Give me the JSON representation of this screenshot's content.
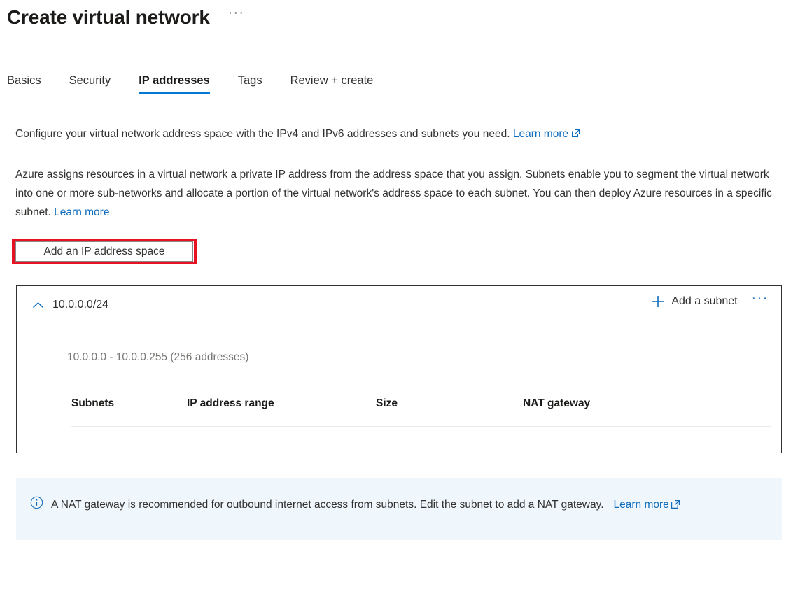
{
  "header": {
    "title": "Create virtual network",
    "ellipsis": "···"
  },
  "tabs": [
    {
      "label": "Basics",
      "active": false
    },
    {
      "label": "Security",
      "active": false
    },
    {
      "label": "IP addresses",
      "active": true
    },
    {
      "label": "Tags",
      "active": false
    },
    {
      "label": "Review + create",
      "active": false
    }
  ],
  "intro": {
    "paragraph1": "Configure your virtual network address space with the IPv4 and IPv6 addresses and subnets you need.",
    "paragraph1_link": "Learn more",
    "paragraph2": "Azure assigns resources in a virtual network a private IP address from the address space that you assign. Subnets enable you to segment the virtual network into one or more sub-networks and allocate a portion of the virtual network's address space to each subnet. You can then deploy Azure resources in a specific subnet.",
    "paragraph2_link": "Learn more"
  },
  "actions": {
    "add_ip_address_space": "Add an IP address space"
  },
  "address_space_card": {
    "cidr": "10.0.0.0/24",
    "range_summary": "10.0.0.0 - 10.0.0.255 (256 addresses)",
    "add_subnet_label": "Add a subnet",
    "ellipsis": "···",
    "table": {
      "columns": [
        "Subnets",
        "IP address range",
        "Size",
        "NAT gateway"
      ],
      "rows": []
    }
  },
  "info_banner": {
    "message": "A NAT gateway is recommended for outbound internet access from subnets. Edit the subnet to add a NAT gateway.",
    "link": "Learn more"
  },
  "colors": {
    "accent": "#0078d4",
    "link": "#0f6cbd",
    "highlight": "#e81123",
    "banner_bg": "#eff6fc",
    "text": "#323130",
    "muted": "#797775"
  },
  "icons": {
    "external_link": "external-link-icon",
    "chevron_up": "chevron-up-icon",
    "plus": "plus-icon",
    "info": "info-circle-icon"
  }
}
